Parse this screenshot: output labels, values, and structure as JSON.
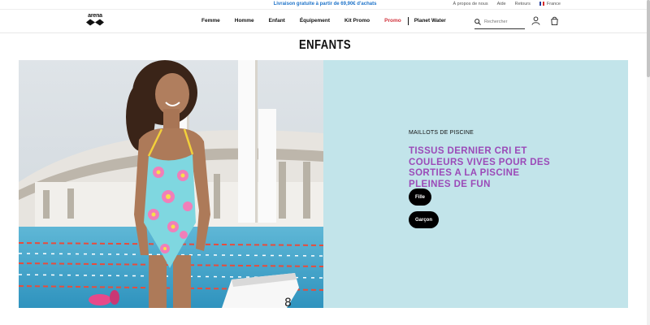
{
  "topbar": {
    "promo": "Livraison gratuite à partir de 69,90€ d'achats",
    "links": [
      "À propos de nous",
      "Aide",
      "Retours"
    ],
    "country": "France"
  },
  "header": {
    "logo_text": "arena",
    "nav": [
      "Femme",
      "Homme",
      "Enfant",
      "Équipement",
      "Kit Promo",
      "Promo",
      "Planet Water"
    ],
    "search_placeholder": "Rechercher"
  },
  "page": {
    "title": "ENFANTS"
  },
  "hero": {
    "kicker": "MAILLOTS DE PISCINE",
    "headline": "TISSUS DERNIER CRI ET COULEURS VIVES POUR DES SORTIES A LA PISCINE PLEINES DE FUN",
    "buttons": [
      "Fille",
      "Garçon"
    ],
    "panel_color": "#c2e4ea",
    "headline_color": "#9b4ab8",
    "lane_number": "8"
  },
  "colors": {
    "promo_bar": "#1e73c9",
    "promo_nav": "#d0313b"
  }
}
